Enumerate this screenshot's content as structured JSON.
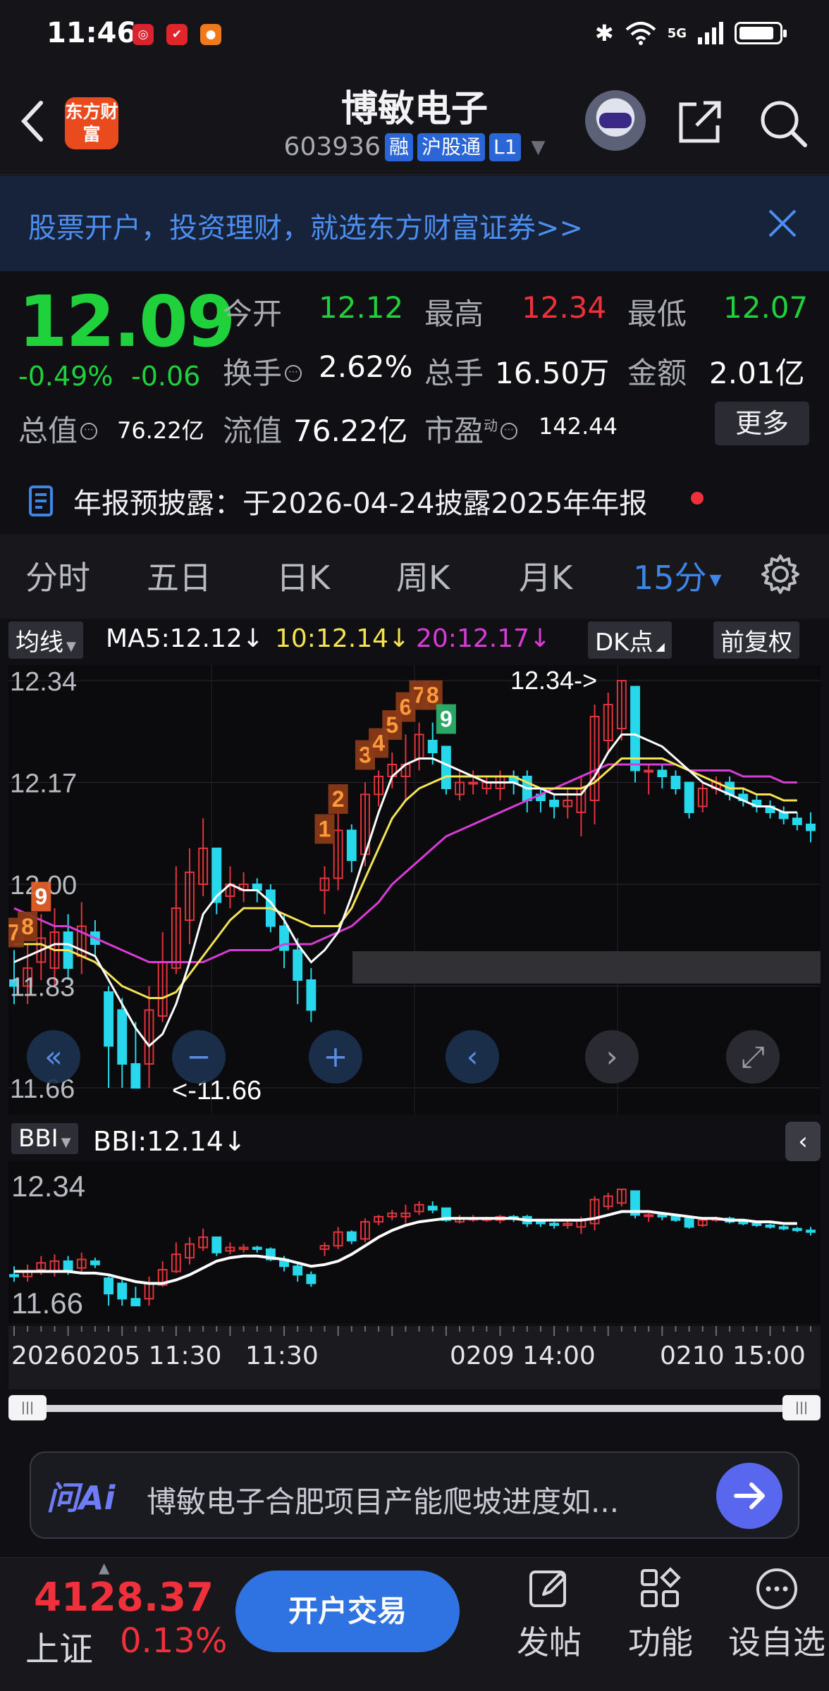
{
  "status_bar": {
    "time": "11:46",
    "network": "5G"
  },
  "header": {
    "logo_text": "东方财富",
    "stock_name": "博敏电子",
    "stock_code": "603936",
    "badges": [
      "融",
      "沪股通",
      "L1"
    ]
  },
  "banner": {
    "text": "股票开户，投资理财，就选东方财富证券>>"
  },
  "quote": {
    "price": "12.09",
    "change_pct": "-0.49%",
    "change_abs": "-0.06",
    "open_label": "今开",
    "open": "12.12",
    "high_label": "最高",
    "high": "12.34",
    "low_label": "最低",
    "low": "12.07",
    "turnover_label": "换手",
    "turnover": "2.62%",
    "volume_label": "总手",
    "volume": "16.50万",
    "amount_label": "金额",
    "amount": "2.01亿",
    "mktcap_label": "总值",
    "mktcap": "76.22亿",
    "float_label": "流值",
    "float_cap": "76.22亿",
    "pe_label": "市盈",
    "pe_sup": "动",
    "pe": "142.44",
    "more": "更多"
  },
  "disclosure": {
    "text": "年报预披露：于2026-04-24披露2025年年报"
  },
  "tabs": [
    "分时",
    "五日",
    "日K",
    "周K",
    "月K",
    "15分"
  ],
  "ma_bar": {
    "mode": "均线",
    "ma5": "MA5:12.12",
    "ma10": "10:12.14",
    "ma20": "20:12.17",
    "dk": "DK点",
    "adjust": "前复权",
    "ma5_color": "#ffffff",
    "ma10_color": "#f5e351",
    "ma20_color": "#d93bd6"
  },
  "chart_data": {
    "type": "candlestick",
    "price_labels": [
      "12.34",
      "12.17",
      "12.00",
      "11.83",
      "11.66"
    ],
    "ylim": [
      11.66,
      12.34
    ],
    "high_marker": "12.34->",
    "low_marker": "<-11.66",
    "td_counts": [
      "7",
      "8",
      "9",
      "1",
      "2",
      "3",
      "4",
      "5",
      "6",
      "7",
      "8",
      "9"
    ],
    "candles": [
      {
        "o": 11.84,
        "c": 11.83,
        "h": 11.89,
        "l": 11.8
      },
      {
        "o": 11.83,
        "c": 11.86,
        "h": 11.9,
        "l": 11.8
      },
      {
        "o": 11.87,
        "c": 11.91,
        "h": 11.95,
        "l": 11.84
      },
      {
        "o": 11.86,
        "c": 11.92,
        "h": 11.96,
        "l": 11.83
      },
      {
        "o": 11.92,
        "c": 11.86,
        "h": 11.95,
        "l": 11.84
      },
      {
        "o": 11.88,
        "c": 11.93,
        "h": 11.97,
        "l": 11.85
      },
      {
        "o": 11.92,
        "c": 11.9,
        "h": 11.94,
        "l": 11.88
      },
      {
        "o": 11.82,
        "c": 11.73,
        "h": 11.83,
        "l": 11.66
      },
      {
        "o": 11.79,
        "c": 11.7,
        "h": 11.81,
        "l": 11.66
      },
      {
        "o": 11.7,
        "c": 11.66,
        "h": 11.77,
        "l": 11.66
      },
      {
        "o": 11.7,
        "c": 11.79,
        "h": 11.83,
        "l": 11.66
      },
      {
        "o": 11.78,
        "c": 11.87,
        "h": 11.92,
        "l": 11.77
      },
      {
        "o": 11.86,
        "c": 11.96,
        "h": 12.03,
        "l": 11.85
      },
      {
        "o": 11.94,
        "c": 12.02,
        "h": 12.06,
        "l": 11.9
      },
      {
        "o": 12.0,
        "c": 12.06,
        "h": 12.11,
        "l": 11.98
      },
      {
        "o": 12.06,
        "c": 11.97,
        "h": 12.06,
        "l": 11.95
      },
      {
        "o": 11.98,
        "c": 12.0,
        "h": 12.03,
        "l": 11.96
      },
      {
        "o": 11.99,
        "c": 12.0,
        "h": 12.02,
        "l": 11.97
      },
      {
        "o": 12.0,
        "c": 11.99,
        "h": 12.01,
        "l": 11.97
      },
      {
        "o": 11.99,
        "c": 11.93,
        "h": 12.0,
        "l": 11.92
      },
      {
        "o": 11.93,
        "c": 11.89,
        "h": 11.95,
        "l": 11.86
      },
      {
        "o": 11.89,
        "c": 11.84,
        "h": 11.91,
        "l": 11.8
      },
      {
        "o": 11.84,
        "c": 11.79,
        "h": 11.86,
        "l": 11.77
      },
      {
        "o": 11.99,
        "c": 12.01,
        "h": 12.03,
        "l": 11.95
      },
      {
        "o": 12.01,
        "c": 12.09,
        "h": 12.12,
        "l": 11.99
      },
      {
        "o": 12.09,
        "c": 12.04,
        "h": 12.1,
        "l": 12.02
      },
      {
        "o": 12.05,
        "c": 12.15,
        "h": 12.17,
        "l": 12.03
      },
      {
        "o": 12.15,
        "c": 12.18,
        "h": 12.19,
        "l": 12.13
      },
      {
        "o": 12.18,
        "c": 12.2,
        "h": 12.22,
        "l": 12.16
      },
      {
        "o": 12.18,
        "c": 12.2,
        "h": 12.25,
        "l": 12.14
      },
      {
        "o": 12.21,
        "c": 12.25,
        "h": 12.27,
        "l": 12.19
      },
      {
        "o": 12.24,
        "c": 12.22,
        "h": 12.27,
        "l": 12.2
      },
      {
        "o": 12.23,
        "c": 12.16,
        "h": 12.23,
        "l": 12.15
      },
      {
        "o": 12.15,
        "c": 12.17,
        "h": 12.19,
        "l": 12.14
      },
      {
        "o": 12.17,
        "c": 12.17,
        "h": 12.19,
        "l": 12.15
      },
      {
        "o": 12.16,
        "c": 12.17,
        "h": 12.18,
        "l": 12.15
      },
      {
        "o": 12.16,
        "c": 12.18,
        "h": 12.19,
        "l": 12.14
      },
      {
        "o": 12.18,
        "c": 12.17,
        "h": 12.19,
        "l": 12.15
      },
      {
        "o": 12.18,
        "c": 12.14,
        "h": 12.19,
        "l": 12.12
      },
      {
        "o": 12.15,
        "c": 12.14,
        "h": 12.16,
        "l": 12.12
      },
      {
        "o": 12.14,
        "c": 12.13,
        "h": 12.15,
        "l": 12.11
      },
      {
        "o": 12.13,
        "c": 12.14,
        "h": 12.16,
        "l": 12.11
      },
      {
        "o": 12.12,
        "c": 12.16,
        "h": 12.18,
        "l": 12.08
      },
      {
        "o": 12.14,
        "c": 12.28,
        "h": 12.3,
        "l": 12.1
      },
      {
        "o": 12.24,
        "c": 12.3,
        "h": 12.32,
        "l": 12.22
      },
      {
        "o": 12.26,
        "c": 12.34,
        "h": 12.34,
        "l": 12.24
      },
      {
        "o": 12.33,
        "c": 12.19,
        "h": 12.33,
        "l": 12.17
      },
      {
        "o": 12.19,
        "c": 12.19,
        "h": 12.2,
        "l": 12.15
      },
      {
        "o": 12.19,
        "c": 12.18,
        "h": 12.2,
        "l": 12.16
      },
      {
        "o": 12.18,
        "c": 12.16,
        "h": 12.19,
        "l": 12.15
      },
      {
        "o": 12.17,
        "c": 12.12,
        "h": 12.17,
        "l": 12.11
      },
      {
        "o": 12.13,
        "c": 12.16,
        "h": 12.17,
        "l": 12.12
      },
      {
        "o": 12.16,
        "c": 12.17,
        "h": 12.18,
        "l": 12.15
      },
      {
        "o": 12.17,
        "c": 12.15,
        "h": 12.18,
        "l": 12.14
      },
      {
        "o": 12.15,
        "c": 12.14,
        "h": 12.16,
        "l": 12.13
      },
      {
        "o": 12.14,
        "c": 12.13,
        "h": 12.15,
        "l": 12.12
      },
      {
        "o": 12.13,
        "c": 12.12,
        "h": 12.14,
        "l": 12.11
      },
      {
        "o": 12.12,
        "c": 12.11,
        "h": 12.13,
        "l": 12.1
      },
      {
        "o": 12.11,
        "c": 12.1,
        "h": 12.12,
        "l": 12.09
      },
      {
        "o": 12.1,
        "c": 12.09,
        "h": 12.12,
        "l": 12.07
      }
    ],
    "ma5": [
      11.87,
      11.88,
      11.89,
      11.9,
      11.9,
      11.89,
      11.88,
      11.84,
      11.8,
      11.76,
      11.73,
      11.75,
      11.8,
      11.87,
      11.95,
      11.98,
      12.0,
      11.99,
      11.99,
      11.97,
      11.94,
      11.9,
      11.87,
      11.89,
      11.92,
      11.98,
      12.05,
      12.12,
      12.18,
      12.2,
      12.21,
      12.21,
      12.2,
      12.19,
      12.18,
      12.17,
      12.17,
      12.17,
      12.16,
      12.16,
      12.15,
      12.15,
      12.15,
      12.18,
      12.22,
      12.25,
      12.25,
      12.24,
      12.23,
      12.21,
      12.19,
      12.17,
      12.16,
      12.15,
      12.14,
      12.13,
      12.13,
      12.12,
      12.12
    ],
    "ma10": [
      11.9,
      11.9,
      11.9,
      11.89,
      11.89,
      11.88,
      11.87,
      11.85,
      11.83,
      11.82,
      11.81,
      11.81,
      11.82,
      11.85,
      11.88,
      11.91,
      11.94,
      11.96,
      11.96,
      11.96,
      11.95,
      11.94,
      11.93,
      11.93,
      11.93,
      11.96,
      12.01,
      12.06,
      12.11,
      12.14,
      12.16,
      12.17,
      12.18,
      12.18,
      12.18,
      12.18,
      12.18,
      12.18,
      12.17,
      12.16,
      12.16,
      12.16,
      12.16,
      12.17,
      12.19,
      12.21,
      12.21,
      12.21,
      12.21,
      12.2,
      12.19,
      12.18,
      12.17,
      12.16,
      12.16,
      12.15,
      12.15,
      12.14,
      12.14
    ],
    "ma20": [
      11.96,
      11.95,
      11.94,
      11.93,
      11.93,
      11.92,
      11.91,
      11.9,
      11.89,
      11.88,
      11.87,
      11.87,
      11.87,
      11.87,
      11.87,
      11.88,
      11.89,
      11.89,
      11.89,
      11.89,
      11.9,
      11.9,
      11.9,
      11.91,
      11.92,
      11.93,
      11.95,
      11.97,
      12.0,
      12.02,
      12.04,
      12.06,
      12.08,
      12.09,
      12.1,
      12.11,
      12.12,
      12.13,
      12.14,
      12.15,
      12.16,
      12.17,
      12.18,
      12.19,
      12.2,
      12.2,
      12.2,
      12.2,
      12.2,
      12.2,
      12.19,
      12.19,
      12.19,
      12.19,
      12.18,
      12.18,
      12.18,
      12.17,
      12.17
    ]
  },
  "chart_controls": [
    "double-left",
    "zoom-out",
    "zoom-in",
    "prev",
    "next",
    "fullscreen"
  ],
  "bbi": {
    "mode": "BBI",
    "value": "BBI:12.14",
    "top_label": "12.34",
    "bottom_label": "11.66",
    "values": [
      11.86,
      11.86,
      11.86,
      11.86,
      11.86,
      11.85,
      11.85,
      11.84,
      11.82,
      11.8,
      11.79,
      11.79,
      11.81,
      11.84,
      11.88,
      11.92,
      11.94,
      11.95,
      11.95,
      11.94,
      11.93,
      11.91,
      11.89,
      11.9,
      11.92,
      11.96,
      12.01,
      12.06,
      12.1,
      12.13,
      12.15,
      12.16,
      12.17,
      12.17,
      12.17,
      12.17,
      12.17,
      12.17,
      12.16,
      12.16,
      12.16,
      12.16,
      12.16,
      12.17,
      12.19,
      12.21,
      12.21,
      12.21,
      12.2,
      12.19,
      12.18,
      12.17,
      12.17,
      12.16,
      12.16,
      12.15,
      12.15,
      12.14,
      12.14
    ]
  },
  "time_axis": [
    "20260205 11:30",
    "11:30",
    "0209 14:00",
    "0210 15:00"
  ],
  "ai": {
    "logo": "问Ai",
    "prompt": "博敏电子合肥项目产能爬坡进度如..."
  },
  "bottom_bar": {
    "index_value": "4128.37",
    "index_name": "上证",
    "index_pct": "0.13%",
    "open_btn": "开户交易",
    "nav": [
      "发帖",
      "功能",
      "设自选"
    ]
  }
}
